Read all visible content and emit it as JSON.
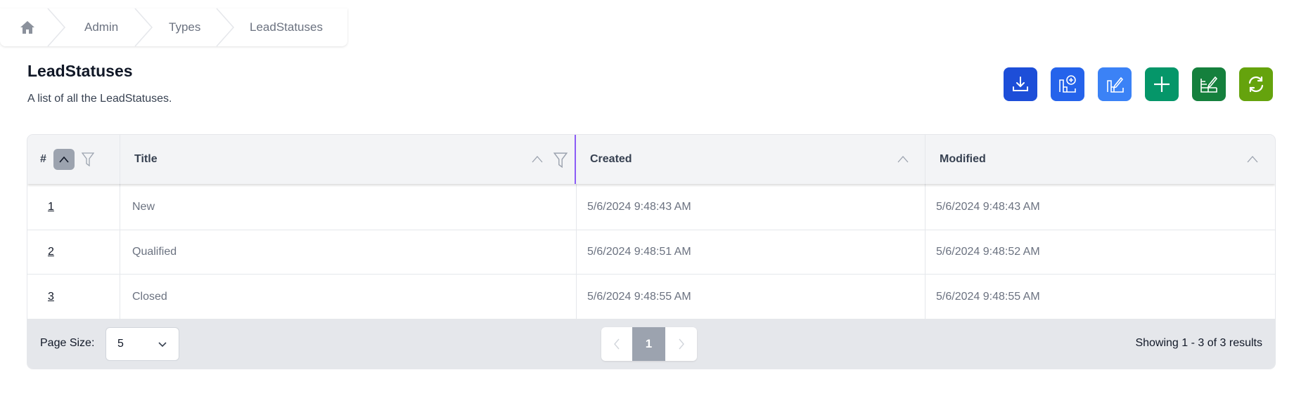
{
  "breadcrumb": {
    "home_icon": "home-icon",
    "items": [
      "Admin",
      "Types",
      "LeadStatuses"
    ]
  },
  "page": {
    "title": "LeadStatuses",
    "subtitle": "A list of all the LeadStatuses."
  },
  "toolbar": [
    {
      "icon": "download-icon",
      "color": "#1d4ed8"
    },
    {
      "icon": "add-column-icon",
      "color": "#2563eb"
    },
    {
      "icon": "edit-column-icon",
      "color": "#3b82f6"
    },
    {
      "icon": "plus-icon",
      "color": "#059669"
    },
    {
      "icon": "edit-table-icon",
      "color": "#15803d"
    },
    {
      "icon": "refresh-icon",
      "color": "#65a30d"
    }
  ],
  "table": {
    "columns": [
      "#",
      "Title",
      "Created",
      "Modified"
    ],
    "rows": [
      {
        "id": "1",
        "title": "New",
        "created": "5/6/2024 9:48:43 AM",
        "modified": "5/6/2024 9:48:43 AM"
      },
      {
        "id": "2",
        "title": "Qualified",
        "created": "5/6/2024 9:48:51 AM",
        "modified": "5/6/2024 9:48:52 AM"
      },
      {
        "id": "3",
        "title": "Closed",
        "created": "5/6/2024 9:48:55 AM",
        "modified": "5/6/2024 9:48:55 AM"
      }
    ]
  },
  "footer": {
    "page_size_label": "Page Size:",
    "page_size": "5",
    "current_page": "1",
    "summary": "Showing 1 - 3 of 3 results"
  }
}
